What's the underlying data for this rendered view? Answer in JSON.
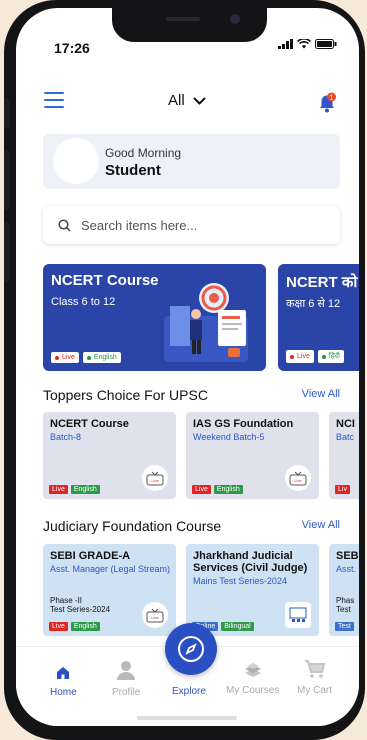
{
  "status": {
    "time": "17:26"
  },
  "header": {
    "filter_label": "All",
    "notification_count": "1"
  },
  "greeting": {
    "line1": "Good Morning",
    "line2": "Student"
  },
  "search": {
    "placeholder": "Search items here..."
  },
  "banners": [
    {
      "title": "NCERT Course",
      "subtitle": "Class 6 to 12",
      "tag_live": "Live",
      "tag_lang": "English"
    },
    {
      "title": "NCERT को",
      "subtitle": "कक्षा 6 से 12",
      "tag_live": "Live",
      "tag_lang": "हिंदी"
    }
  ],
  "sections": [
    {
      "title": "Toppers Choice For UPSC",
      "view_all": "View All",
      "cards": [
        {
          "title": "NCERT Course",
          "subtitle": "Batch-8",
          "tags": [
            "Live",
            "English"
          ],
          "badge": "Live"
        },
        {
          "title": "IAS GS Foundation",
          "subtitle": "Weekend Batch-5",
          "tags": [
            "Live",
            "English"
          ],
          "badge": "Live"
        },
        {
          "title": "NCI",
          "subtitle": "Batc",
          "tags": [
            "Liv"
          ]
        }
      ]
    },
    {
      "title": "Judiciary Foundation Course",
      "view_all": "View All",
      "cards": [
        {
          "title": "SEBI GRADE-A",
          "subtitle": "Asst. Manager (Legal Stream)",
          "line3": "Phase -II",
          "line4": "Test Series-2024",
          "tags": [
            "Live",
            "English"
          ],
          "badge": "Live"
        },
        {
          "title": "Jharkhand Judicial Services (Civil Judge)",
          "subtitle": "Mains Test Series-2024",
          "tags": [
            "Online",
            "Bilingual"
          ]
        },
        {
          "title": "SEB",
          "subtitle": "Asst.",
          "line3": "Phas",
          "line4": "Test",
          "tags": [
            "Test"
          ]
        }
      ]
    }
  ],
  "nav": {
    "home": "Home",
    "profile": "Profile",
    "explore": "Explore",
    "courses": "My Courses",
    "cart": "My Cart"
  },
  "colors": {
    "primary": "#2b4fc6",
    "banner": "#2b44a8",
    "live": "#e02525",
    "english": "#2e9a49"
  }
}
